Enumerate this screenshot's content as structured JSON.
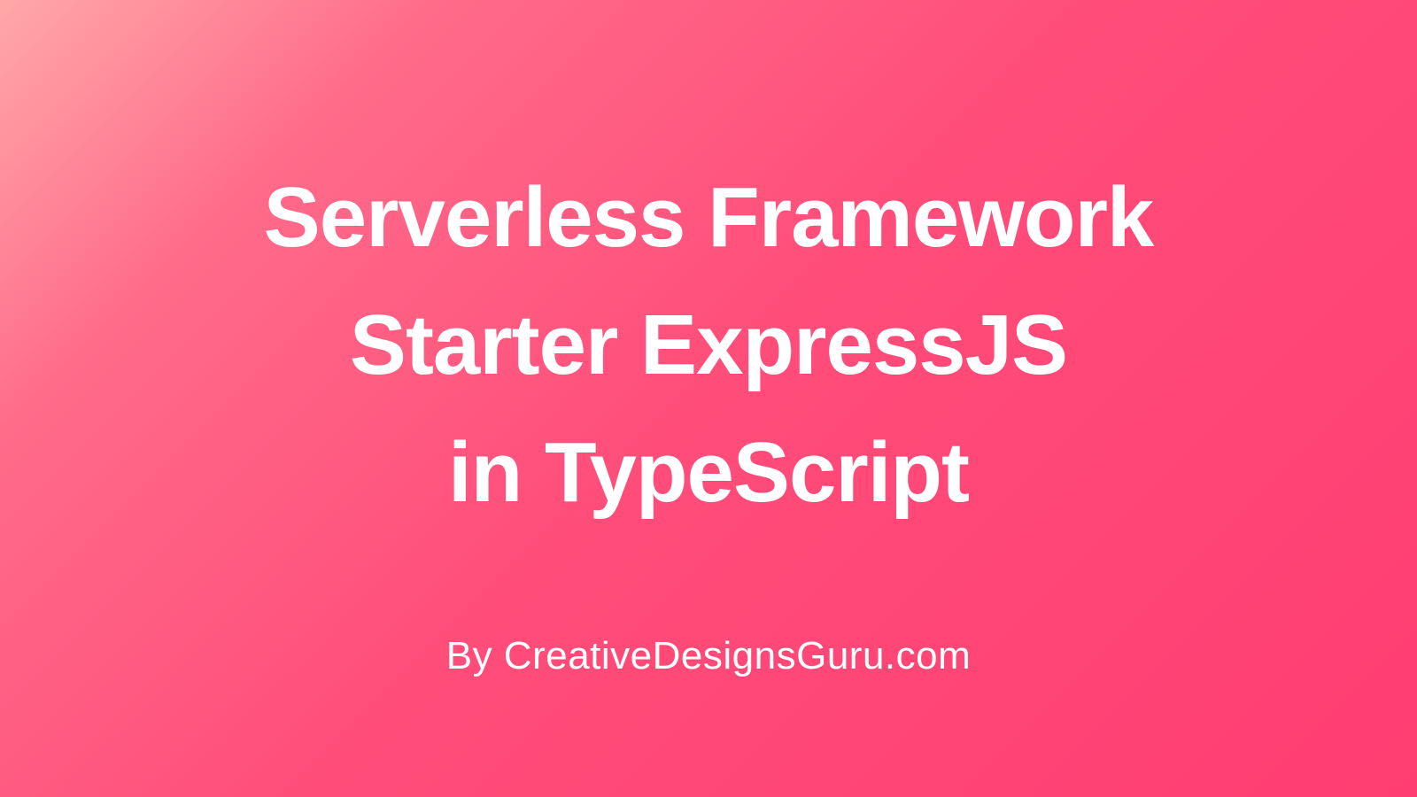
{
  "title": {
    "line1": "Serverless Framework",
    "line2": "Starter ExpressJS",
    "line3": "in TypeScript"
  },
  "byline": "By CreativeDesignsGuru.com",
  "colors": {
    "gradientStart": "#ffa8a8",
    "gradientEnd": "#ff3d72",
    "text": "#ffffff"
  }
}
